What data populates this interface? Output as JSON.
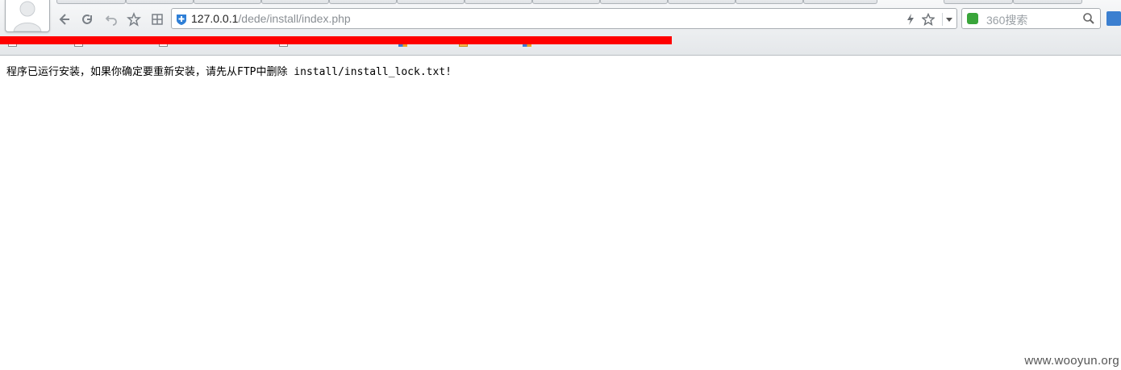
{
  "browser": {
    "address_host": "127.0.0.1",
    "address_path": "/dede/install/index.php",
    "search_placeholder": "360搜索",
    "icons": {
      "back": "arrow-left-icon",
      "refresh": "refresh-icon",
      "undo": "undo-icon",
      "favorite": "star-icon",
      "apps": "grid-icon",
      "security": "shield-icon",
      "speed": "lightning-icon",
      "bookmark_star": "star-icon",
      "dropdown": "chevron-down-icon",
      "search_engine": "360-search-icon",
      "search": "magnifier-icon"
    },
    "bookmarks": [
      "",
      "",
      "",
      "",
      "",
      "",
      "",
      ""
    ]
  },
  "page": {
    "message": "程序已运行安装，如果你确定要重新安装，请先从FTP中删除 install/install_lock.txt!"
  },
  "watermark": "www.wooyun.org",
  "colors": {
    "redaction": "#ff0000",
    "shield": "#2f7fd6",
    "search_engine": "#39a53a"
  }
}
